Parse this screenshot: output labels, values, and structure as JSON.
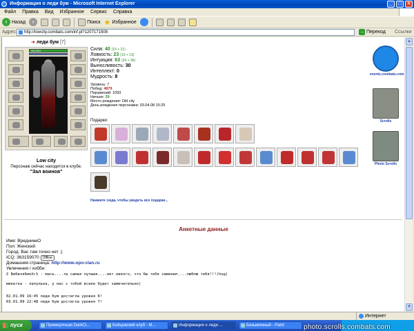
{
  "window": {
    "title": "Информация о леди бум - Microsoft Internet Explorer"
  },
  "menu": [
    "Файл",
    "Правка",
    "Вид",
    "Избранное",
    "Сервис",
    "Справка"
  ],
  "toolbar": {
    "back": "Назад",
    "search": "Поиск",
    "favorites": "Избранное"
  },
  "address": {
    "label": "Адрес:",
    "url": "http://lowcity.combats.com/inf.pl?1207171508",
    "go": "Переход",
    "links": "Ссылки"
  },
  "character": {
    "name": "леди бум",
    "level_badge": "[7]",
    "hp": "261/261",
    "city": "Low city",
    "club_status": "Персонаж сейчас находится в клубе.",
    "location": "\"Зал воинов\""
  },
  "stats": [
    {
      "label": "Сила:",
      "value": "40",
      "detail": "(19 + 21)"
    },
    {
      "label": "Ловкость:",
      "value": "23",
      "detail": "(10 + 13)"
    },
    {
      "label": "Интуиция:",
      "value": "63",
      "detail": "(24 + 39)"
    },
    {
      "label": "Выносливость:",
      "value": "30",
      "detail": ""
    },
    {
      "label": "Интеллект:",
      "value": "0",
      "detail": ""
    },
    {
      "label": "Мудрость:",
      "value": "8",
      "detail": ""
    }
  ],
  "info": [
    {
      "label": "Уровень:",
      "value": "7"
    },
    {
      "label": "Побед:",
      "value": "4879"
    },
    {
      "label": "Поражений:",
      "value": "1093"
    },
    {
      "label": "Ничьих:",
      "value": "26"
    },
    {
      "label": "Место рождения:",
      "value": "Old city"
    },
    {
      "label": "День рождения персонажа:",
      "value": "03.04.08 15:25"
    }
  ],
  "gifts": {
    "label": "Подарки:",
    "more": "Нажмите сюда, чтобы увидеть все подарки...",
    "colors": [
      "#c0392b",
      "#d9b0d9",
      "#9aa8b8",
      "#b0b8c8",
      "#c04a4a",
      "#a8321e",
      "#b8262a",
      "#d8c8b8",
      "#5a8ad0",
      "#7a7ad0",
      "#c03030",
      "#7a2a2a",
      "#c8c0b8",
      "#c02a2a",
      "#d03030",
      "#c03838",
      "#5a8ad0",
      "#c02a2a",
      "#c03030",
      "#c03434",
      "#5a8ad0",
      "#4a3a2a"
    ]
  },
  "side": [
    {
      "icon": "events-icon",
      "caption": "events.combats.com"
    },
    {
      "icon": "scrolls-icon",
      "caption": "Scrolls"
    },
    {
      "icon": "photo-scrolls-icon",
      "caption": "Photo Scrolls"
    }
  ],
  "profile": {
    "title": "Анкетные данные",
    "lines": [
      "Имя: ВреднинкО",
      "Пол: Женский",
      "Город: Вас там точно нет ;)"
    ],
    "icq_label": "ICQ: 363159070",
    "icq_status": "Offline",
    "homepage_label": "Домашняя страница:",
    "homepage_url": "http://www.opo-clan.ru",
    "hobby_label": "Увлечения / хобби:",
    "hobby_lines": [
      "Ƨ Бибизябикλгλ - масъ....ты самая лучшая....нет никого, что бы тебя заменил....люблю тебя!!!(hug)",
      "микетка - лапулька, у нас с тобой всеее будет замечательно)"
    ],
    "log_lines": [
      "02.01.09 16:45 леди бум достигла уровня 6!",
      "03.01.09 22:48 леди бум достигла уровня 7!"
    ]
  },
  "status": {
    "zone": "Интернет"
  },
  "taskbar": {
    "start": "пуск",
    "tasks": [
      "Примерочная DarkCl...",
      "Бойцовский клуб - М...",
      "Информация о леди ...",
      "Безымянный - Paint"
    ]
  },
  "watermark": "photo.scrolls.combats.com"
}
